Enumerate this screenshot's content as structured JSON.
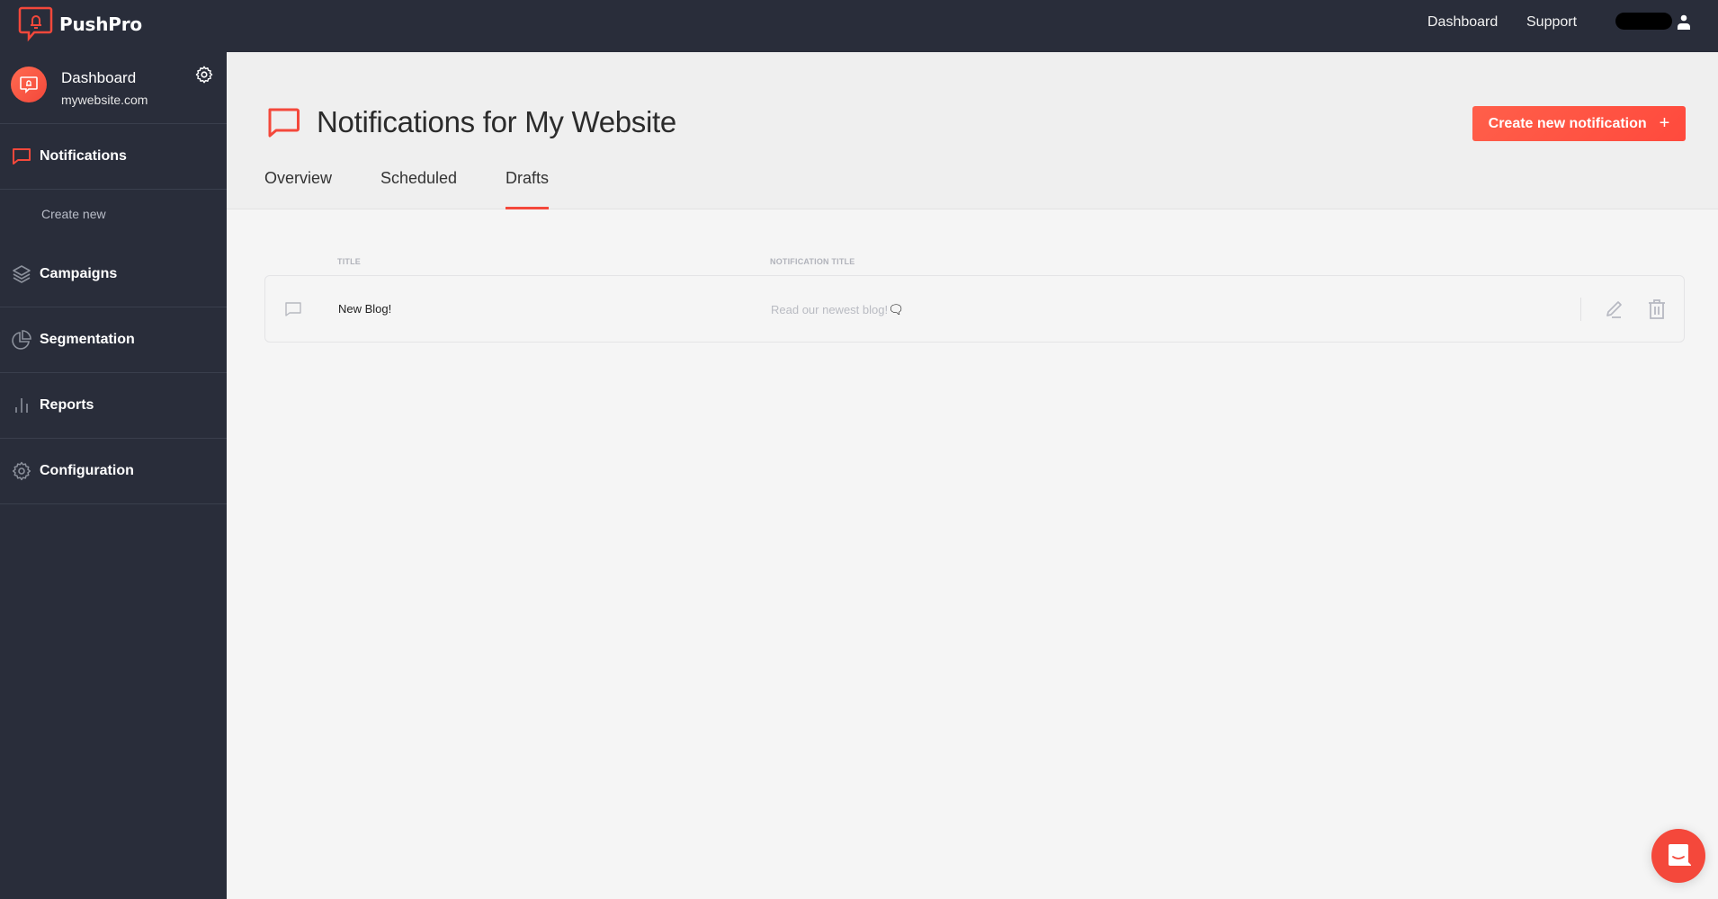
{
  "app": {
    "brand": "PushPro",
    "accent_color": "#f4483b",
    "sidebar_bg": "#292d3a"
  },
  "topnav": {
    "links": [
      {
        "label": "Dashboard",
        "icon": "none"
      },
      {
        "label": "Support",
        "icon": "none"
      }
    ],
    "user_icon": "user-icon"
  },
  "sidebar": {
    "site": {
      "name": "Dashboard",
      "domain": "mywebsite.com",
      "settings_icon": "gear-icon"
    },
    "items": [
      {
        "label": "Notifications",
        "icon": "speech-bubble-icon",
        "active": true
      },
      {
        "label": "Create new",
        "sub": true
      },
      {
        "label": "Campaigns",
        "icon": "layers-icon"
      },
      {
        "label": "Segmentation",
        "icon": "pie-chart-icon"
      },
      {
        "label": "Reports",
        "icon": "bar-chart-icon"
      },
      {
        "label": "Configuration",
        "icon": "gear-icon"
      }
    ]
  },
  "header": {
    "title": "Notifications for My Website",
    "create_button": "Create new notification",
    "create_button_icon": "+",
    "tabs": [
      {
        "label": "Overview",
        "active": false
      },
      {
        "label": "Scheduled",
        "active": false
      },
      {
        "label": "Drafts",
        "active": true
      }
    ]
  },
  "table": {
    "columns": [
      "TITLE",
      "NOTIFICATION TITLE"
    ],
    "rows": [
      {
        "icon": "speech-bubble-icon",
        "title": "New Blog!",
        "notification_title": "Read our newest blog!",
        "notification_emoji": "🗨",
        "actions": [
          "edit-icon",
          "trash-icon"
        ]
      }
    ]
  },
  "chat_launcher": {
    "icon": "chat-smile-icon"
  }
}
